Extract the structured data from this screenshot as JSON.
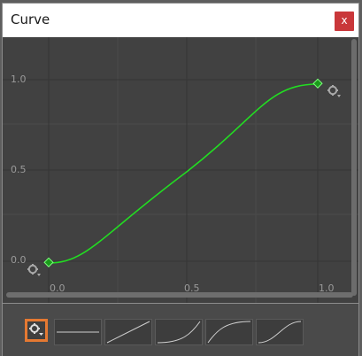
{
  "window": {
    "title": "Curve",
    "close_label": "x"
  },
  "curve_editor": {
    "y_axis_labels": [
      "1.0",
      "0.5",
      "0.0"
    ],
    "x_axis_labels": [
      "0.0",
      "0.5",
      "1.0"
    ],
    "curve_color": "#22dd22",
    "key_color": "#1a9a1a",
    "keys": [
      {
        "time": 0.0,
        "value": 0.0
      },
      {
        "time": 1.0,
        "value": 1.0
      }
    ],
    "key_settings_icon": "gear-dropdown-icon"
  },
  "presets": {
    "settings_icon": "gear-dropdown-icon",
    "accent": "#e57932",
    "items": [
      "constant",
      "linear",
      "ease-in",
      "ease-out",
      "ease-in-out"
    ]
  }
}
